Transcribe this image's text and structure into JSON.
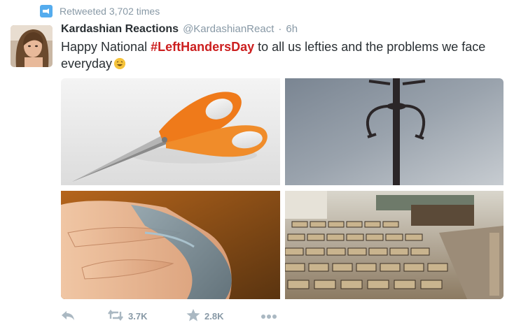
{
  "context": {
    "text": "Retweeted 3,702 times",
    "icon": "retweet-badge-icon"
  },
  "author": {
    "fullname": "Kardashian Reactions",
    "username": "@KardashianReact",
    "separator": "·",
    "time": "6h"
  },
  "tweet": {
    "text_before": "Happy National ",
    "hashtag": "#LeftHandersDay",
    "text_after": " to all us lefties and the problems we face everyday",
    "emoji": "laughing-face-emoji"
  },
  "media": [
    {
      "name": "photo-scissors"
    },
    {
      "name": "photo-coat-hooks"
    },
    {
      "name": "photo-smudged-hand"
    },
    {
      "name": "photo-lecture-hall-desks"
    }
  ],
  "actions": {
    "reply_icon": "reply-icon",
    "retweet_icon": "retweet-icon",
    "retweet_count": "3.7K",
    "favorite_icon": "star-icon",
    "favorite_count": "2.8K",
    "more_icon": "more-icon"
  },
  "colors": {
    "accent": "#55acee",
    "hashtag": "#cc1f1f",
    "muted": "#8899a6",
    "text": "#292f33"
  }
}
